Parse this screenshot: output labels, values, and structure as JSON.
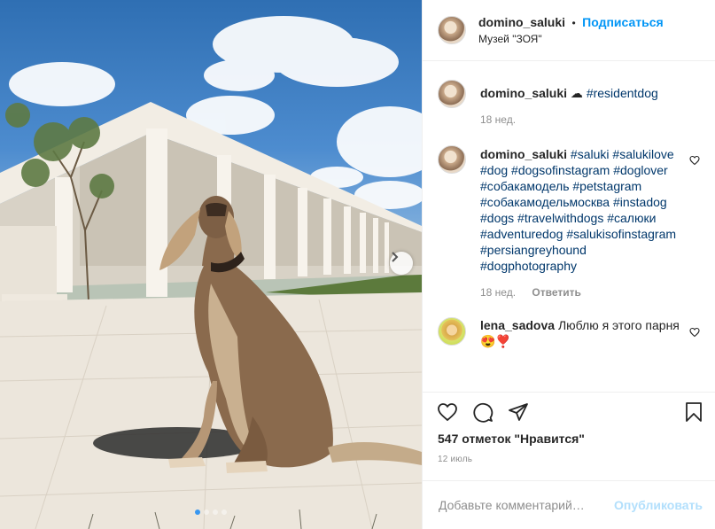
{
  "post": {
    "author": {
      "username": "domino_saluki",
      "separator": "•",
      "follow_label": "Подписаться",
      "location": "Музей \"ЗОЯ\""
    },
    "image": {
      "description_icon": "dog-photo",
      "carousel_dots": 4,
      "active_dot": 0,
      "next_icon": "chevron-right-icon"
    },
    "caption": {
      "username": "domino_saluki",
      "text_prefix": "☁️ ",
      "hashtag": "#residentdog",
      "time": "18 нед."
    },
    "comments": [
      {
        "username": "domino_saluki",
        "hashtags": [
          "#saluki",
          "#salukilove",
          "#dog",
          "#dogsofinstagram",
          "#doglover",
          "#собакамодель",
          "#petstagram",
          "#собакамодельмосква",
          "#instadog",
          "#dogs",
          "#travelwithdogs",
          "#салюки",
          "#adventuredog",
          "#salukisofinstagram",
          "#persiangreyhound",
          "#dogphotography"
        ],
        "time": "18 нед.",
        "reply_label": "Ответить"
      },
      {
        "username": "lena_sadova",
        "text": "Люблю я этого парня😍❣️"
      }
    ],
    "likes_label": "547 отметок \"Нравится\"",
    "date_label": "12 июль",
    "comment_placeholder": "Добавьте комментарий…",
    "publish_label": "Опубликовать",
    "colors": {
      "link": "#0095f6",
      "hashtag": "#00376b",
      "publish_disabled": "#b2dffc",
      "muted": "#8e8e8e"
    }
  }
}
